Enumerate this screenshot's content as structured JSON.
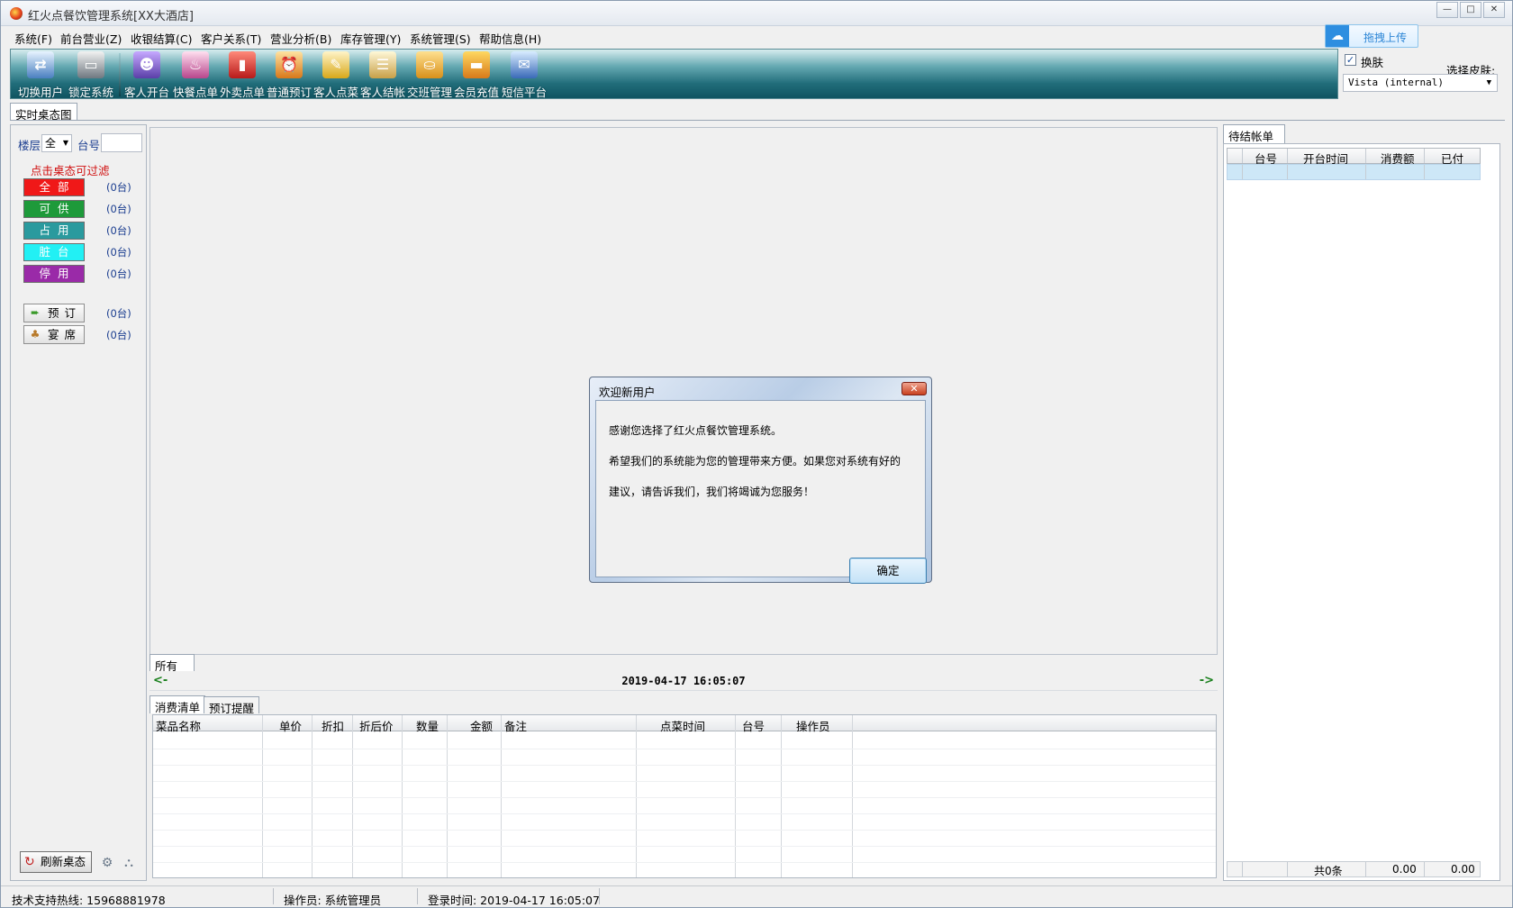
{
  "window": {
    "title": "红火点餐饮管理系统[XX大酒店]",
    "controls": [
      "—",
      "□",
      "✕"
    ]
  },
  "menu": [
    "系统(F)",
    "前台营业(Z)",
    "收银结算(C)",
    "客户关系(T)",
    "营业分析(B)",
    "库存管理(Y)",
    "系统管理(S)",
    "帮助信息(H)"
  ],
  "upload_button": "拖拽上传",
  "toolbar": [
    {
      "label": "切换用户",
      "icon": "switch-user-icon"
    },
    {
      "label": "锁定系统",
      "icon": "lock-system-icon"
    },
    {
      "label": "客人开台",
      "icon": "open-table-icon"
    },
    {
      "label": "快餐点单",
      "icon": "fast-order-icon"
    },
    {
      "label": "外卖点单",
      "icon": "takeout-order-icon"
    },
    {
      "label": "普通预订",
      "icon": "reservation-icon"
    },
    {
      "label": "客人点菜",
      "icon": "order-dish-icon"
    },
    {
      "label": "客人结帐",
      "icon": "checkout-icon"
    },
    {
      "label": "交班管理",
      "icon": "shift-handover-icon"
    },
    {
      "label": "会员充值",
      "icon": "member-recharge-icon"
    },
    {
      "label": "短信平台",
      "icon": "sms-platform-icon"
    }
  ],
  "skin": {
    "checkbox_label": "换肤",
    "checked": true,
    "select_label": "选择皮肤:",
    "select_value": "Vista (internal)"
  },
  "tabs": {
    "realtime": "实时桌态图",
    "pending": "待结帐单",
    "all": "所有",
    "consumption": "消费清单",
    "reservation_reminder": "预订提醒"
  },
  "left": {
    "floor_label": "楼层",
    "floor_value": "全",
    "table_label": "台号",
    "table_value": "",
    "hint": "点击桌态可过滤",
    "statuses": [
      {
        "label": "全部",
        "count": "(0台)",
        "color": "#f01818"
      },
      {
        "label": "可供",
        "count": "(0台)",
        "color": "#1e9a3a"
      },
      {
        "label": "占用",
        "count": "(0台)",
        "color": "#2a9a9e"
      },
      {
        "label": "脏台",
        "count": "(0台)",
        "color": "#22f0f4"
      },
      {
        "label": "停用",
        "count": "(0台)",
        "color": "#9a2aa8"
      }
    ],
    "extras": [
      {
        "label": "预订",
        "count": "(0台)",
        "icon": "arrow-right-icon"
      },
      {
        "label": "宴席",
        "count": "(0台)",
        "icon": "banquet-icon"
      }
    ],
    "refresh_label": "刷新桌态"
  },
  "datetime": "2019-04-17  16:05:07",
  "nav": {
    "prev": "<-",
    "next": "->"
  },
  "order_columns": [
    "菜品名称",
    "单价",
    "折扣",
    "折后价",
    "数量",
    "金额",
    "备注",
    "点菜时间",
    "台号",
    "操作员"
  ],
  "bill": {
    "columns": [
      "台号",
      "开台时间",
      "消费额",
      "已付"
    ],
    "footer_count": "共0条",
    "footer_amount": "0.00",
    "footer_paid": "0.00"
  },
  "status_bar": {
    "support": "技术支持热线: 15968881978",
    "operator": "操作员: 系统管理员",
    "login_time": "登录时间: 2019-04-17 16:05:07"
  },
  "dialog": {
    "title": "欢迎新用户",
    "close": "✕",
    "line1": "感谢您选择了红火点餐饮管理系统。",
    "line2": "希望我们的系统能为您的管理带来方便。如果您对系统有好的",
    "line3": "建议，请告诉我们，我们将竭诚为您服务！",
    "ok": "确定"
  }
}
